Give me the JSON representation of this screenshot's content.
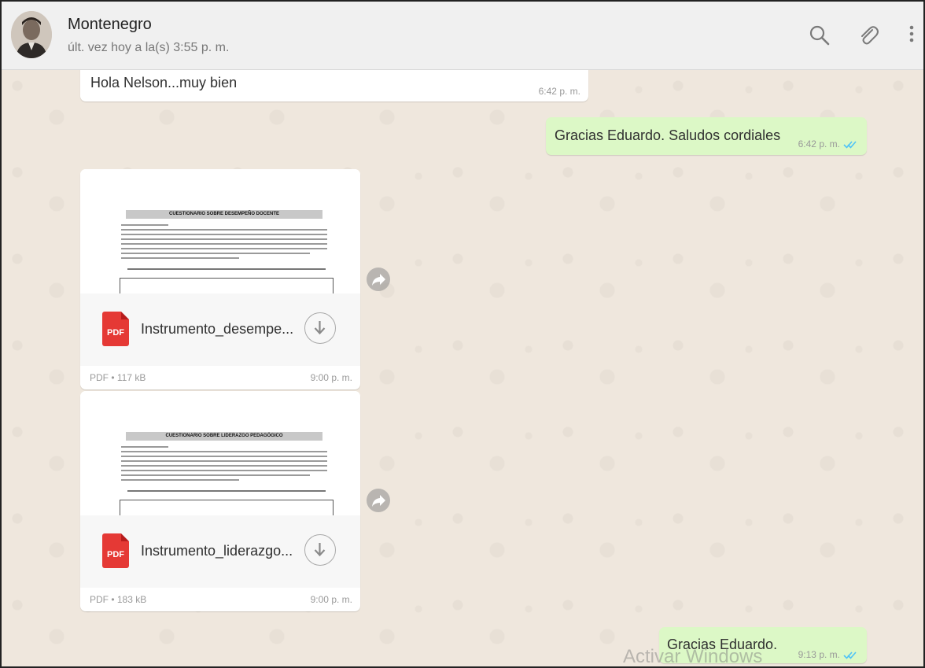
{
  "header": {
    "contact_name": "Montenegro",
    "last_seen": "últ. vez hoy a la(s) 3:55 p. m.",
    "icons": [
      "search-icon",
      "attach-icon",
      "menu-icon"
    ]
  },
  "messages": [
    {
      "direction": "in",
      "text": "Hola Nelson...muy bien",
      "time": "6:42 p. m."
    },
    {
      "direction": "out",
      "text": "Gracias Eduardo. Saludos cordiales",
      "time": "6:42 p. m.",
      "status": "read"
    },
    {
      "direction": "in",
      "type": "document",
      "preview_title": "CUESTIONARIO SOBRE DESEMPEÑO DOCENTE",
      "file_name": "Instrumento_desempe...",
      "file_meta": "PDF • 117 kB",
      "time": "9:00 p. m.",
      "file_type": "PDF"
    },
    {
      "direction": "in",
      "type": "document",
      "preview_title": "CUESTIONARIO SOBRE LIDERAZGO PEDAGÓGICO",
      "file_name": "Instrumento_liderazgo...",
      "file_meta": "PDF • 183 kB",
      "time": "9:00 p. m.",
      "file_type": "PDF"
    },
    {
      "direction": "out",
      "text": "Gracias Eduardo.",
      "time": "9:13 p. m.",
      "status": "read"
    }
  ],
  "overlay": {
    "watermark": "Activar Windows"
  },
  "colors": {
    "chat_bg": "#efe7dd",
    "outgoing_bubble": "#dcf8c6",
    "incoming_bubble": "#ffffff",
    "read_ticks": "#4fc3f7",
    "pdf_icon": "#e53935"
  }
}
